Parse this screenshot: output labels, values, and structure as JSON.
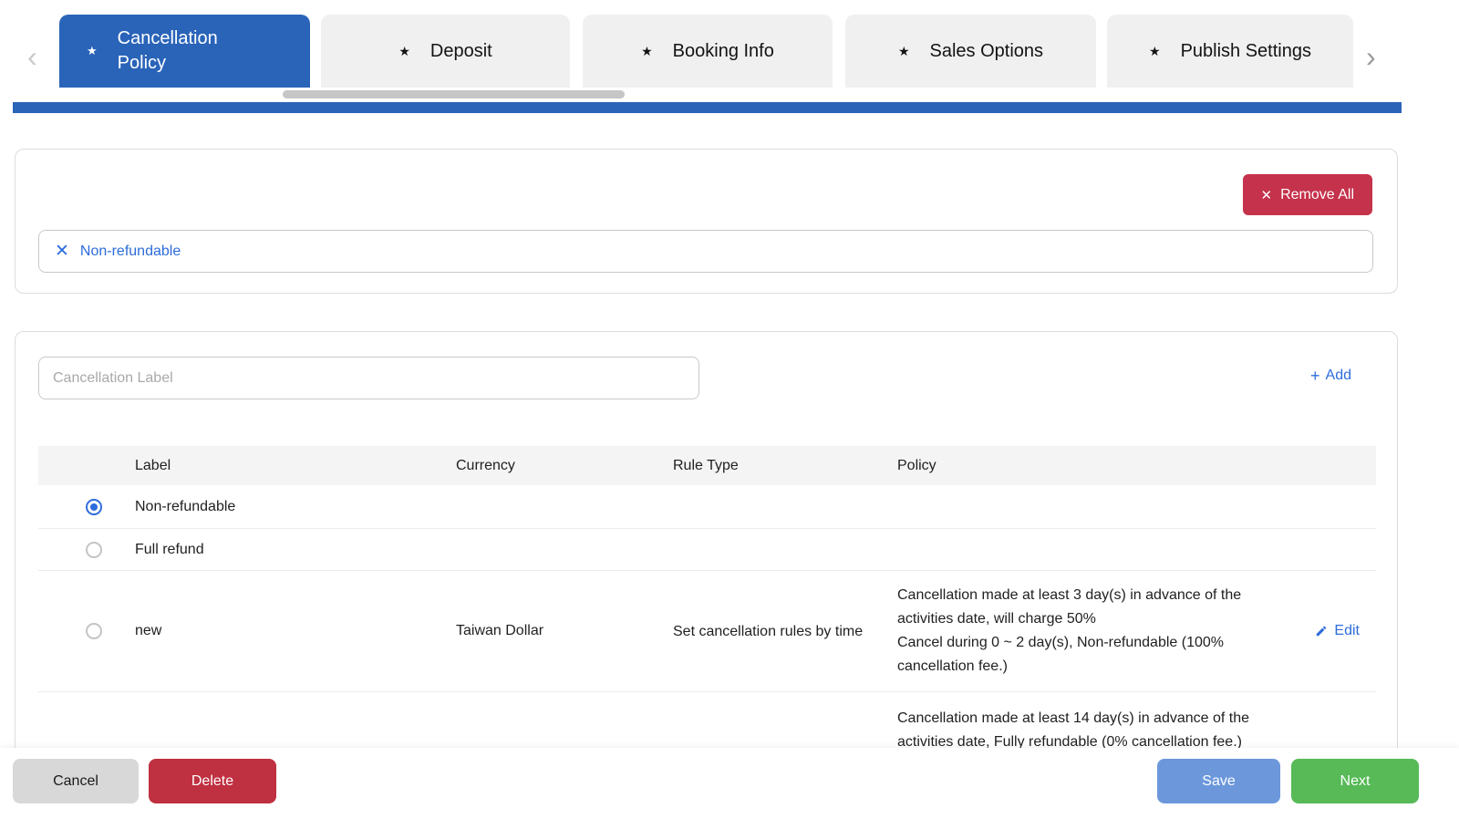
{
  "icons": {
    "star": "★",
    "chevron_left": "‹",
    "chevron_right": "›",
    "close": "✕",
    "plus": "+"
  },
  "tabs": {
    "items": [
      {
        "label": "Cancellation Policy",
        "active": true
      },
      {
        "label": "Deposit",
        "active": false
      },
      {
        "label": "Booking Info",
        "active": false
      },
      {
        "label": "Sales Options",
        "active": false
      },
      {
        "label": "Publish Settings",
        "active": false
      }
    ]
  },
  "selected_policies": {
    "remove_all_label": "Remove All",
    "items": [
      {
        "label": "Non-refundable"
      }
    ]
  },
  "policy_editor": {
    "label_input": {
      "value": "",
      "placeholder": "Cancellation Label"
    },
    "add_label": "Add",
    "table": {
      "headers": {
        "label": "Label",
        "currency": "Currency",
        "rule_type": "Rule Type",
        "policy": "Policy"
      },
      "rows": [
        {
          "label": "Non-refundable",
          "currency": "",
          "rule_type": "",
          "policy": "",
          "selected": true
        },
        {
          "label": "Full refund",
          "currency": "",
          "rule_type": "",
          "policy": "",
          "selected": false
        },
        {
          "label": "new",
          "currency": "Taiwan Dollar",
          "rule_type": "Set cancellation rules by time",
          "policy": "Cancellation made at least 3 day(s) in advance of the activities date, will charge 50%\nCancel during 0 ~ 2 day(s), Non-refundable (100% cancellation fee.)",
          "edit_label": "Edit",
          "selected": false
        },
        {
          "label": "",
          "currency": "",
          "rule_type": "",
          "policy": "Cancellation made at least 14 day(s) in advance of the activities date, Fully refundable (0% cancellation fee.)",
          "selected": false
        }
      ]
    }
  },
  "footer": {
    "cancel_label": "Cancel",
    "delete_label": "Delete",
    "save_label": "Save",
    "next_label": "Next"
  },
  "colors": {
    "primary_blue": "#2a64b9",
    "accent_blue": "#2d6cdb",
    "remove_red": "#c5324b",
    "delete_red": "#bf3040",
    "save_blue": "#6c98db",
    "next_green": "#57ba57",
    "tab_inactive_bg": "#f0f0f0",
    "table_header_bg": "#f4f4f5"
  }
}
